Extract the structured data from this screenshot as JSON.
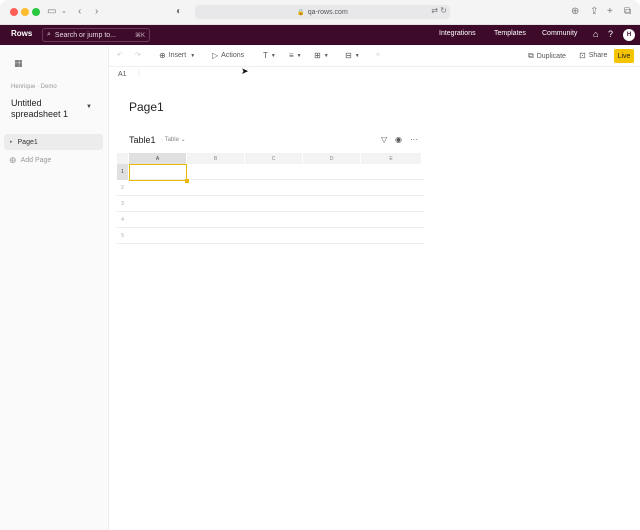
{
  "browser": {
    "url": "qa-rows.com"
  },
  "header": {
    "logo": "Rows",
    "search_placeholder": "Search or jump to...",
    "search_shortcut": "⌘K",
    "nav": [
      "Integrations",
      "Templates",
      "Community"
    ],
    "avatar_initial": "H"
  },
  "sidebar": {
    "breadcrumb": "Henrique · Demo",
    "title": "Untitled spreadsheet 1",
    "pages": [
      {
        "label": "Page1"
      }
    ],
    "add_page": "Add Page"
  },
  "toolbar": {
    "insert": "Insert",
    "actions": "Actions",
    "duplicate": "Duplicate",
    "share": "Share",
    "live": "Live"
  },
  "cell_ref": "A1",
  "page": {
    "title": "Page1",
    "table_title": "Table1",
    "table_type": "Table"
  },
  "grid": {
    "columns": [
      "A",
      "B",
      "C",
      "D",
      "E"
    ],
    "rows": [
      "1",
      "2",
      "3",
      "4",
      "5"
    ],
    "selected_cell": "A1"
  }
}
